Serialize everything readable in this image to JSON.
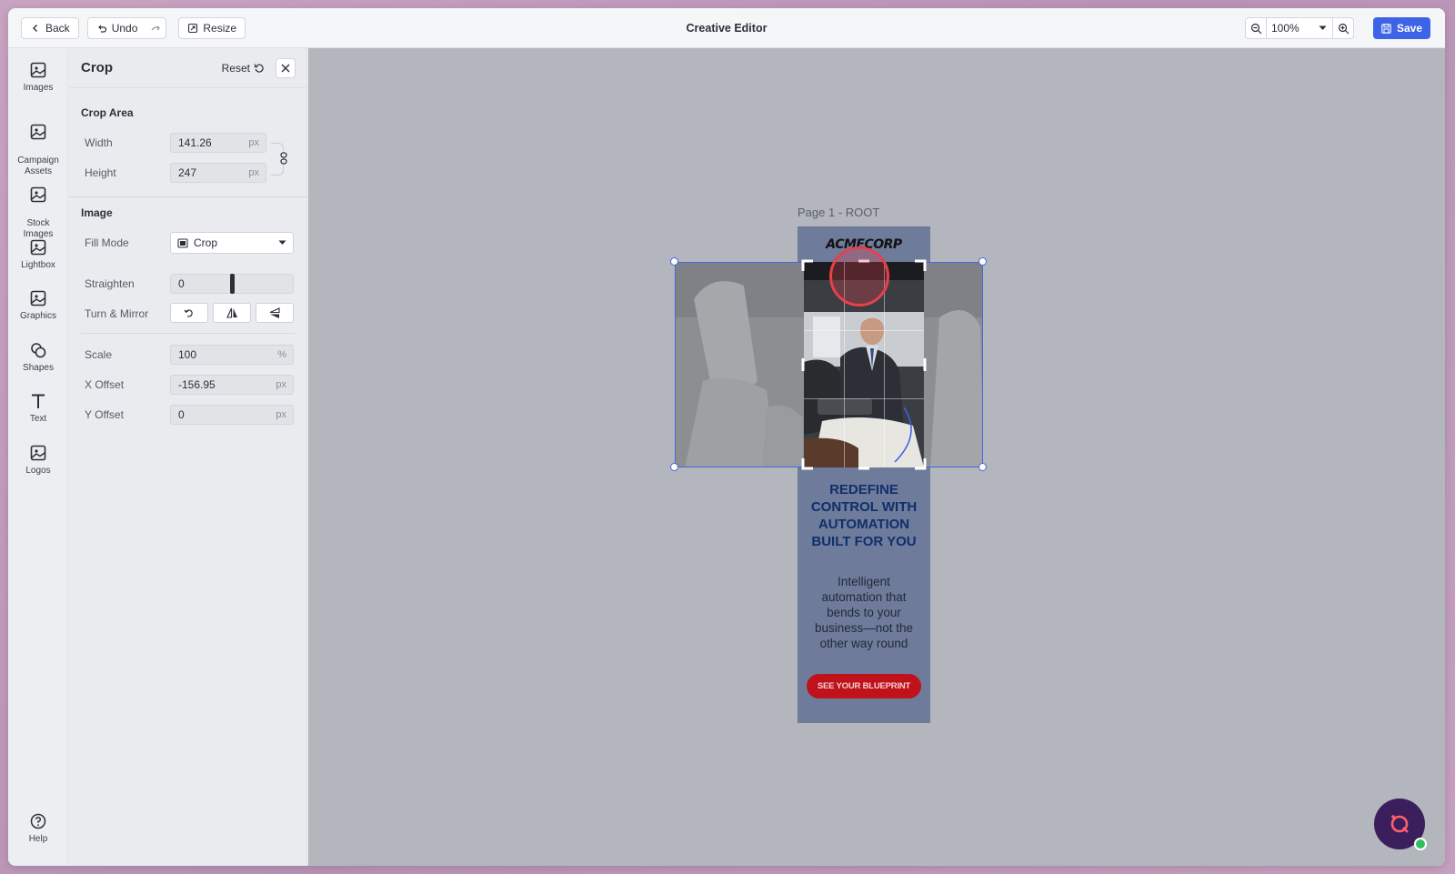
{
  "topbar": {
    "back_label": "Back",
    "undo_label": "Undo",
    "resize_label": "Resize",
    "title": "Creative Editor",
    "zoom_value": "100%",
    "save_label": "Save"
  },
  "rail": {
    "items": [
      {
        "label": "Images",
        "icon": "image-icon"
      },
      {
        "label": "Campaign\nAssets",
        "icon": "image-icon"
      },
      {
        "label": "Stock\nImages",
        "icon": "image-icon"
      },
      {
        "label": "Lightbox",
        "icon": "image-icon"
      },
      {
        "label": "Graphics",
        "icon": "image-icon"
      },
      {
        "label": "Shapes",
        "icon": "shapes-icon"
      },
      {
        "label": "Text",
        "icon": "text-icon"
      },
      {
        "label": "Logos",
        "icon": "image-icon"
      }
    ],
    "help_label": "Help"
  },
  "panel": {
    "title": "Crop",
    "reset_label": "Reset",
    "crop_area": {
      "heading": "Crop Area",
      "width_label": "Width",
      "width_value": "141.26",
      "height_label": "Height",
      "height_value": "247",
      "unit_px": "px"
    },
    "image": {
      "heading": "Image",
      "fill_mode_label": "Fill Mode",
      "fill_mode_value": "Crop",
      "straighten_label": "Straighten",
      "straighten_value": "0",
      "turn_mirror_label": "Turn & Mirror",
      "scale_label": "Scale",
      "scale_value": "100",
      "scale_unit": "%",
      "x_offset_label": "X Offset",
      "x_offset_value": "-156.95",
      "y_offset_label": "Y Offset",
      "y_offset_value": "0"
    }
  },
  "canvas": {
    "page_label": "Page 1 - ROOT",
    "ad": {
      "brand": "ACMECORP",
      "headline": "REDEFINE CONTROL WITH AUTOMATION BUILT FOR YOU",
      "subtext": "Intelligent automation that bends to your business—not the other way round",
      "cta": "SEE YOUR BLUEPRINT"
    }
  },
  "colors": {
    "accent": "#3d63e6",
    "cta_red": "#c0121b",
    "headline_blue": "#0f2f6b",
    "page_bg": "#6e7b9a"
  }
}
